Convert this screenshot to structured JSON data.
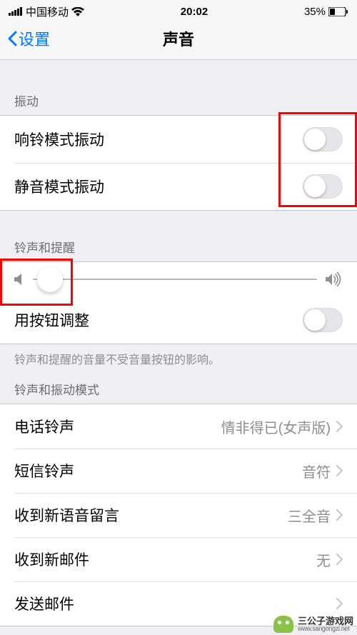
{
  "status": {
    "carrier": "中国移动",
    "time": "20:02",
    "battery": "35%"
  },
  "nav": {
    "back": "设置",
    "title": "声音"
  },
  "sections": {
    "vibration": {
      "header": "振动",
      "ring_label": "响铃模式振动",
      "silent_label": "静音模式振动"
    },
    "ringer": {
      "header": "铃声和提醒",
      "button_change_label": "用按钮调整",
      "footer": "铃声和提醒的音量不受音量按钮的影响。",
      "slider_value": 6
    },
    "patterns": {
      "header": "铃声和振动模式",
      "items": [
        {
          "label": "电话铃声",
          "value": "情非得已(女声版)"
        },
        {
          "label": "短信铃声",
          "value": "音符"
        },
        {
          "label": "收到新语音留言",
          "value": "三全音"
        },
        {
          "label": "收到新邮件",
          "value": "无"
        },
        {
          "label": "发送邮件",
          "value": ""
        }
      ]
    }
  },
  "watermark": {
    "name": "三公子游戏网",
    "url": "www.sangongzi.net"
  }
}
